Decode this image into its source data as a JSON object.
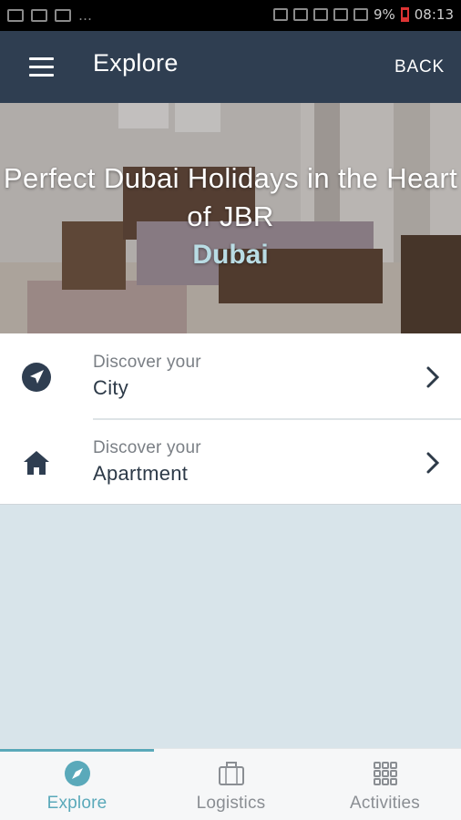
{
  "status_bar": {
    "battery": "9%",
    "time": "08:13"
  },
  "app_bar": {
    "title": "Explore",
    "back_label": "BACK"
  },
  "hero": {
    "title": "Perfect Dubai Holidays in the Heart of JBR",
    "subtitle": "Dubai"
  },
  "menu": {
    "items": [
      {
        "kicker": "Discover your",
        "label": "City",
        "icon": "navigation-arrow-icon"
      },
      {
        "kicker": "Discover your",
        "label": "Apartment",
        "icon": "home-icon"
      }
    ]
  },
  "tabs": [
    {
      "label": "Explore",
      "icon": "compass-icon",
      "active": true
    },
    {
      "label": "Logistics",
      "icon": "briefcase-icon",
      "active": false
    },
    {
      "label": "Activities",
      "icon": "grid-icon",
      "active": false
    }
  ],
  "colors": {
    "app_bar": "#2f3e51",
    "accent": "#5aa9ba",
    "background": "#d8e4ea"
  }
}
